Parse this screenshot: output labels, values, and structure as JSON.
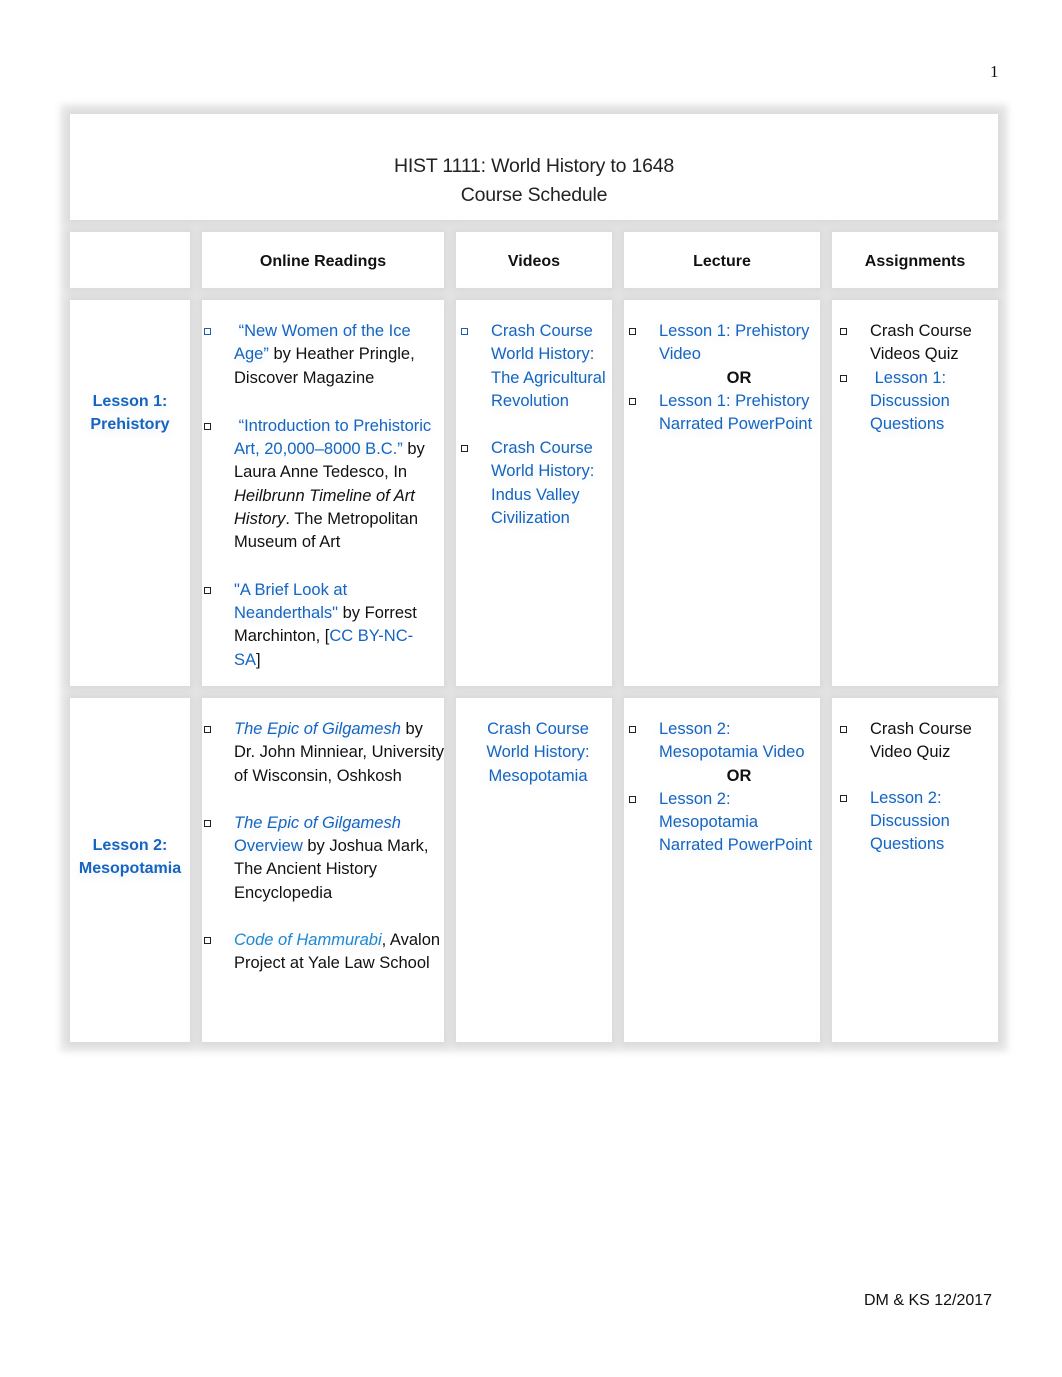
{
  "page_number": "1",
  "footer": "DM & KS 12/2017",
  "title": {
    "line1": "HIST 1111: World History to 1648",
    "line2": "Course Schedule"
  },
  "headers": [
    "",
    "Online Readings",
    "Videos",
    "Lecture",
    "Assignments"
  ],
  "colors": {
    "link": "#1565c0",
    "link_alt": "#1e88d0",
    "text": "#111111"
  },
  "bullet_icon": "hollow-square",
  "lessons": [
    {
      "label_line1": "Lesson 1:",
      "label_line2": "Prehistory",
      "readings": [
        {
          "link": "“New Women of the Ice Age”",
          "rest": " by Heather Pringle, Discover Magazine"
        },
        {
          "link": "“Introduction to Prehistoric Art, 20,000–8000 B.C.”",
          "rest1": " by Laura Anne Tedesco, In ",
          "italic": "Heilbrunn Timeline of Art History",
          "rest2": ". The Metropolitan Museum of Art"
        },
        {
          "link": "\"A Brief Look at Neanderthals\"",
          "rest1": " by Forrest Marchinton, [",
          "link2": "CC BY-NC-SA",
          "rest2": "]"
        }
      ],
      "videos": [
        "Crash Course World History: The Agricultural Revolution",
        "Crash Course World History: Indus Valley Civilization"
      ],
      "lecture": {
        "option1": "Lesson 1: Prehistory Video",
        "or": "OR",
        "option2": "Lesson 1: Prehistory Narrated PowerPoint"
      },
      "assignments": [
        {
          "text": "Crash Course Videos Quiz",
          "is_link": false
        },
        {
          "text": "Lesson 1: Discussion Questions",
          "is_link": true
        }
      ]
    },
    {
      "label_line1": "Lesson 2:",
      "label_line2": "Mesopotamia",
      "readings": [
        {
          "link_italic": "The Epic of Gilgamesh",
          "rest": " by Dr. John Minniear, University of Wisconsin, Oshkosh"
        },
        {
          "link_italic": "The Epic of Gilgamesh",
          "link": " Overview",
          "rest": " by Joshua Mark, The Ancient History Encyclopedia"
        },
        {
          "link_italic": "Code of Hammurabi",
          "rest": ", Avalon Project at Yale Law School"
        }
      ],
      "videos": [
        "Crash Course World History: Mesopotamia"
      ],
      "lecture": {
        "option1": "Lesson 2: Mesopotamia Video",
        "or": "OR",
        "option2": "Lesson 2: Mesopotamia Narrated PowerPoint"
      },
      "assignments": [
        {
          "text": "Crash Course Video Quiz",
          "is_link": false
        },
        {
          "text": "Lesson 2: Discussion Questions",
          "is_link": true
        }
      ]
    }
  ]
}
